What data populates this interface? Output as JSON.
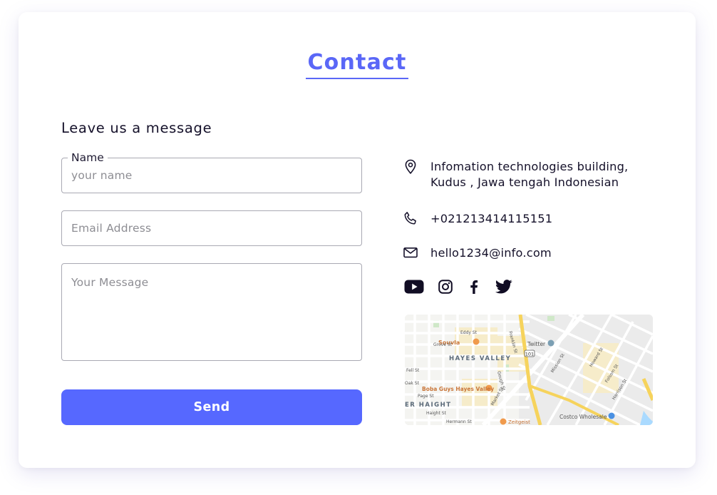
{
  "header": {
    "title": "Contact"
  },
  "form": {
    "heading": "Leave us a message",
    "name": {
      "label": "Name",
      "placeholder": "your name",
      "value": ""
    },
    "email": {
      "placeholder": "Email Address",
      "value": ""
    },
    "message": {
      "placeholder": "Your Message",
      "value": ""
    },
    "send_label": "Send"
  },
  "contact": {
    "address_line1": "Infomation technologies building,",
    "address_line2": "Kudus , Jawa tengah Indonesian",
    "phone": "+021213414115151",
    "email": "hello1234@info.com"
  },
  "socials": [
    {
      "icon": "youtube-icon"
    },
    {
      "icon": "instagram-icon"
    },
    {
      "icon": "facebook-icon"
    },
    {
      "icon": "twitter-icon"
    }
  ],
  "map": {
    "labels": {
      "hayes_valley": "HAYES VALLEY",
      "haight": "ER HAIGHT",
      "souvla": "Souvla",
      "twitter": "Twitter",
      "boba": "Boba Guys Hayes Valley",
      "costco": "Costco Wholesale",
      "zeitgeist": "Zeitgeist",
      "franklin": "Franklin St",
      "gough": "Gough St",
      "market": "Market St",
      "mission": "Mission St",
      "howard": "Howard St",
      "folsom": "Folsom St",
      "harrison": "Harrison St",
      "fell": "Fell St",
      "oak": "Oak St",
      "page": "Page St",
      "grove": "Grove St",
      "haight_st": "Haight St",
      "hermann": "Hermann St",
      "eddy": "Eddy St",
      "hwy": "101"
    }
  },
  "colors": {
    "accent": "#5668ff",
    "title": "#5a67f7",
    "text": "#15112a",
    "border": "#a9a9b3"
  }
}
